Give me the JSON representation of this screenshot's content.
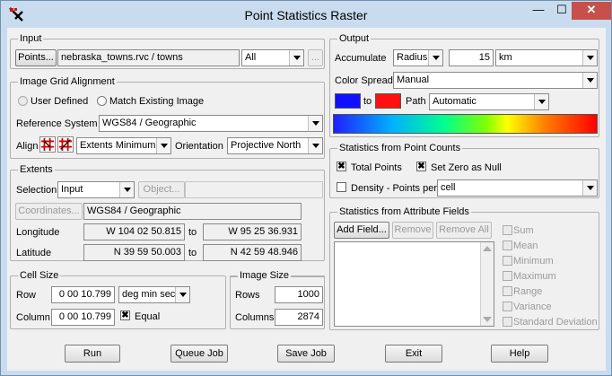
{
  "window": {
    "title": "Point Statistics Raster",
    "minimize": "—",
    "maximize": "☐",
    "close": "✕"
  },
  "input": {
    "group": "Input",
    "points_button": "Points...",
    "points_value": "nebraska_towns.rvc / towns",
    "filter_value": "All",
    "browse_button": "..."
  },
  "grid": {
    "group": "Image Grid Alignment",
    "user_defined": "User Defined",
    "match_existing": "Match Existing Image",
    "ref_label": "Reference System",
    "ref_value": "WGS84 / Geographic",
    "align_label": "Align",
    "align_value": "Extents Minimum",
    "orient_label": "Orientation",
    "orient_value": "Projective North"
  },
  "extents": {
    "group": "Extents",
    "selection_label": "Selection",
    "selection_value": "Input",
    "object_button": "Object...",
    "object_value": "",
    "coords_button": "Coordinates...",
    "coords_value": "WGS84 / Geographic",
    "lon_label": "Longitude",
    "lon_from": "W 104 02 50.815",
    "to1": "to",
    "lon_to": "W 95 25 36.931",
    "lat_label": "Latitude",
    "lat_from": "N 39 59 50.003",
    "to2": "to",
    "lat_to": "N 42 59 48.946"
  },
  "cell": {
    "group": "Cell Size",
    "row_label": "Row",
    "row_value": "0 00 10.799",
    "unit_value": "deg min sec",
    "col_label": "Column",
    "col_value": "0 00 10.799",
    "equal_label": "Equal",
    "equal_checked": true
  },
  "image": {
    "group": "Image Size",
    "rows_label": "Rows",
    "rows_value": "1000",
    "cols_label": "Columns",
    "cols_value": "2874"
  },
  "output": {
    "group": "Output",
    "accumulate_label": "Accumulate",
    "accumulate_value": "Radius",
    "radius_value": "15",
    "radius_unit": "km",
    "spread_label": "Color Spread",
    "spread_value": "Manual",
    "from_color": "#1010ff",
    "to_label": "to",
    "to_color": "#ff1010",
    "path_label": "Path",
    "path_value": "Automatic"
  },
  "counts": {
    "group": "Statistics from Point Counts",
    "total_points": "Total Points",
    "total_checked": true,
    "zero_null": "Set Zero as Null",
    "zero_checked": true,
    "density_label": "Density - Points per",
    "density_checked": false,
    "density_unit": "cell"
  },
  "attr": {
    "group": "Statistics from Attribute Fields",
    "add_field": "Add Field...",
    "remove": "Remove",
    "remove_all": "Remove All",
    "stats": [
      "Sum",
      "Mean",
      "Minimum",
      "Maximum",
      "Range",
      "Variance",
      "Standard Deviation"
    ]
  },
  "footer": {
    "run": "Run",
    "queue": "Queue Job",
    "save": "Save Job",
    "exit": "Exit",
    "help": "Help"
  }
}
